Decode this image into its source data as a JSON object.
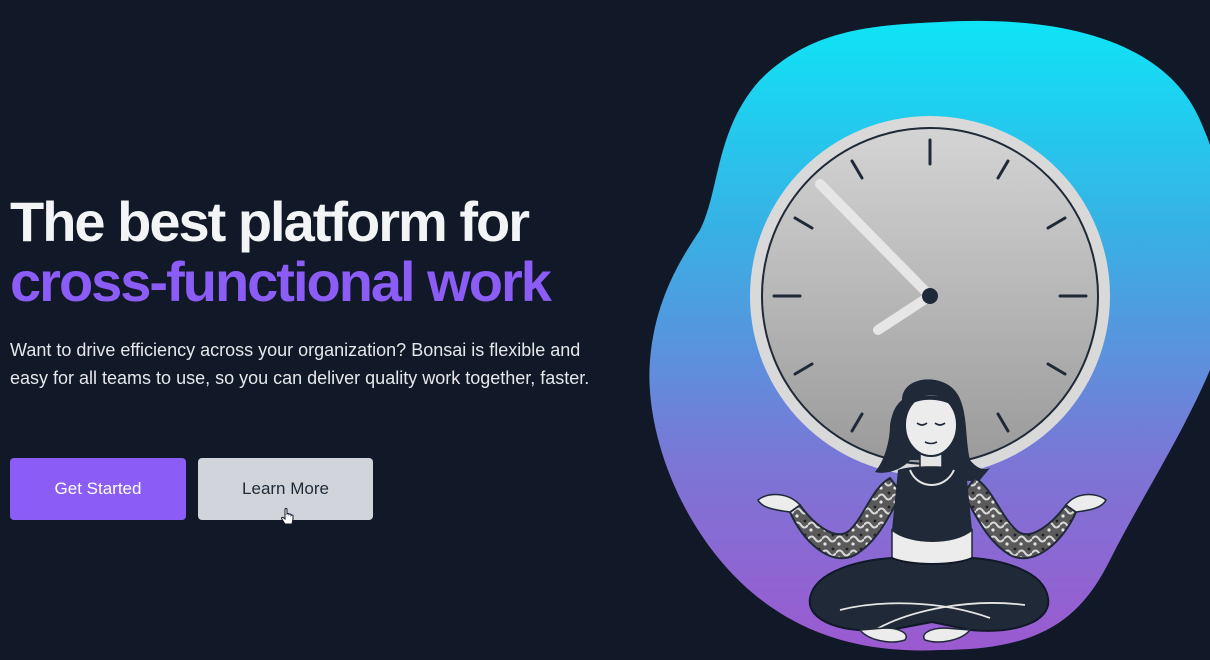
{
  "hero": {
    "headline_line1": "The best platform for",
    "headline_line2": "cross-functional work",
    "description": "Want to drive efficiency across your organization? Bonsai is flexible and easy for all teams to use, so you can deliver quality work together, faster."
  },
  "buttons": {
    "primary_label": "Get Started",
    "secondary_label": "Learn More"
  },
  "colors": {
    "background": "#111827",
    "accent": "#8b5cf6",
    "secondary_button": "#d1d5db",
    "blob_top": "#22d3ee",
    "blob_bottom": "#8b5cf6"
  },
  "illustration": {
    "clock_icon": "clock-icon",
    "person_icon": "meditating-person-icon"
  }
}
